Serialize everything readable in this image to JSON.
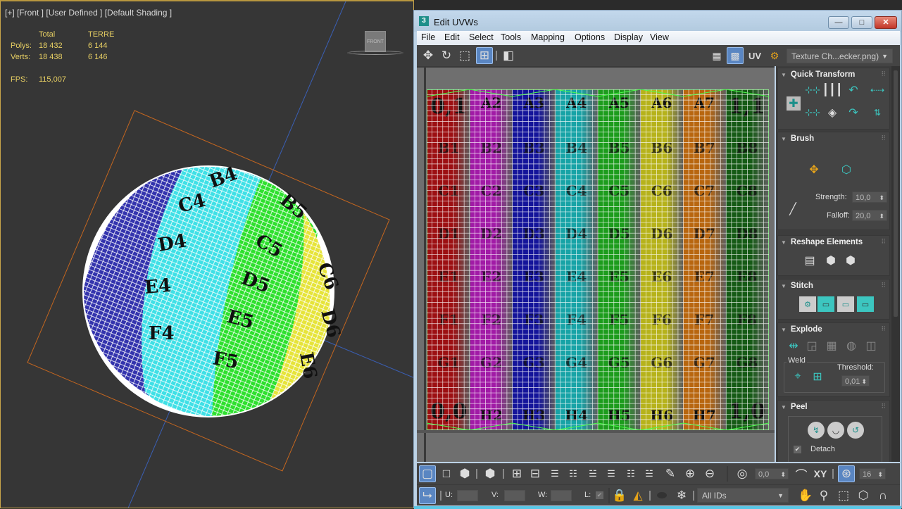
{
  "viewport": {
    "label": "[+] [Front ] [User Defined ] [Default Shading ]",
    "stats": {
      "col_total": "Total",
      "col_object": "TERRE",
      "polys_label": "Polys:",
      "polys_total": "18 432",
      "polys_object": "6 144",
      "verts_label": "Verts:",
      "verts_total": "18 438",
      "verts_object": "6 146",
      "fps_label": "FPS:",
      "fps_value": "115,007"
    },
    "viewcube_label": "FRONT",
    "sphere_labels": [
      "B4",
      "C4",
      "D4",
      "E4",
      "F4",
      "B5",
      "C5",
      "D5",
      "E5",
      "F5",
      "C6",
      "D6",
      "E6"
    ]
  },
  "uv_editor": {
    "title": "Edit UVWs",
    "app_icon": "3",
    "window_buttons": {
      "minimize": "—",
      "maximize": "□",
      "close": "✕"
    },
    "menu": [
      "File",
      "Edit",
      "Select",
      "Tools",
      "Mapping",
      "Options",
      "Display",
      "View"
    ],
    "top_toolbar": {
      "tools": [
        "move-icon",
        "rotate-icon",
        "scale-icon",
        "freeform-icon",
        "mirror-icon"
      ],
      "uv_label": "UV",
      "texture_dropdown": "Texture Ch...ecker.png)"
    },
    "texture": {
      "columns": [
        {
          "color": "#9c0f12",
          "top": "0,1",
          "bottom": "0,0",
          "rows": [
            "B1",
            "C1",
            "D1",
            "E1",
            "F1",
            "G1"
          ]
        },
        {
          "color": "#a11aa6",
          "top": "A2",
          "bottom": "H2",
          "rows": [
            "B2",
            "C2",
            "D2",
            "E2",
            "F2",
            "G2"
          ]
        },
        {
          "color": "#14149a",
          "top": "A3",
          "bottom": "H3",
          "rows": [
            "B3",
            "C3",
            "D3",
            "E3",
            "F3",
            "G3"
          ]
        },
        {
          "color": "#17a3a6",
          "top": "A4",
          "bottom": "H4",
          "rows": [
            "B4",
            "C4",
            "D4",
            "E4",
            "F4",
            "G4"
          ]
        },
        {
          "color": "#1c9c1c",
          "top": "A5",
          "bottom": "H5",
          "rows": [
            "B5",
            "C5",
            "D5",
            "E5",
            "F5",
            "G5"
          ]
        },
        {
          "color": "#b6b21a",
          "top": "A6",
          "bottom": "H6",
          "rows": [
            "B6",
            "C6",
            "D6",
            "E6",
            "F6",
            "G6"
          ]
        },
        {
          "color": "#b8660f",
          "top": "A7",
          "bottom": "H7",
          "rows": [
            "B7",
            "C7",
            "D7",
            "E7",
            "F7",
            "G7"
          ]
        },
        {
          "color": "#155a15",
          "top": "1,1",
          "bottom": "1,0",
          "rows": [
            "B8",
            "C8",
            "D8",
            "E8",
            "F8",
            "G8"
          ]
        }
      ]
    },
    "panel": {
      "quick_transform": {
        "title": "Quick Transform"
      },
      "brush": {
        "title": "Brush",
        "strength_label": "Strength:",
        "strength_value": "10,0",
        "falloff_label": "Falloff:",
        "falloff_value": "20,0"
      },
      "reshape": {
        "title": "Reshape Elements"
      },
      "stitch": {
        "title": "Stitch"
      },
      "explode": {
        "title": "Explode",
        "weld_label": "Weld",
        "threshold_label": "Threshold:",
        "threshold_value": "0,01"
      },
      "peel": {
        "title": "Peel",
        "detach_label": "Detach",
        "detach_checked": true
      }
    },
    "bottom_toolbar": {
      "angle_value": "0,0",
      "xy_label": "XY",
      "grid_value": "16",
      "u_label": "U:",
      "v_label": "V:",
      "w_label": "W:",
      "l_label": "L:",
      "ids_dropdown": "All IDs"
    }
  }
}
